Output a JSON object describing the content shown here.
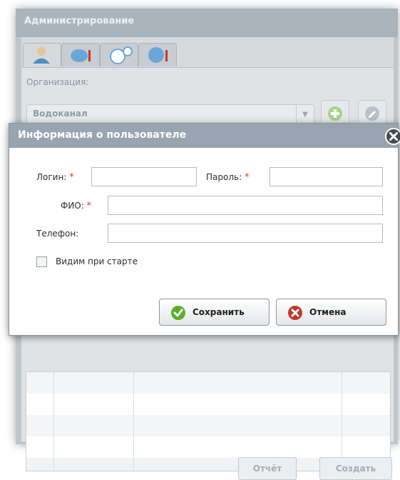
{
  "admin": {
    "title": "Администрирование",
    "tabs": [
      "user-icon",
      "pipes-icon",
      "gauges-icon",
      "map-icon"
    ],
    "org_label": "Организация:",
    "org_value": "Водоканал",
    "bottom_buttons": {
      "report": "Отчёт",
      "create": "Создать"
    }
  },
  "dialog": {
    "title": "Информация о пользователе",
    "login_label": "Логин:",
    "password_label": "Пароль:",
    "fio_label": "ФИО:",
    "phone_label": "Телефон:",
    "required_mark": "*",
    "login_value": "",
    "password_value": "",
    "fio_value": "",
    "phone_value": "",
    "checkbox_label": "Видим при старте",
    "checkbox_checked": false,
    "save_label": "Сохранить",
    "cancel_label": "Отмена"
  },
  "colors": {
    "save_icon": "#5cae2e",
    "cancel_icon": "#c0392b",
    "required": "#e23a2b",
    "header": "#98a5b0"
  }
}
